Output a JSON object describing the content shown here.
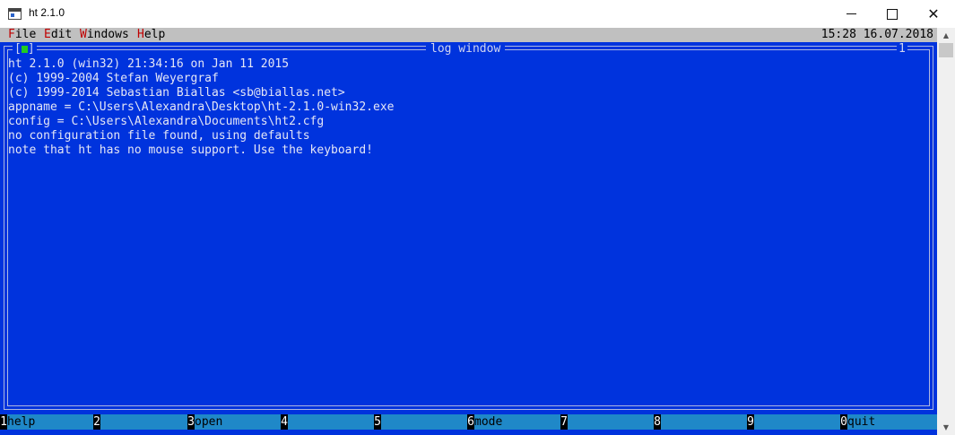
{
  "window": {
    "title": "ht 2.1.0"
  },
  "menubar": {
    "items": [
      {
        "hotkey": "F",
        "rest": "ile"
      },
      {
        "hotkey": "E",
        "rest": "dit"
      },
      {
        "hotkey": "W",
        "rest": "indows"
      },
      {
        "hotkey": "H",
        "rest": "elp"
      }
    ],
    "clock": "15:28 16.07.2018"
  },
  "log_window": {
    "title": "log window",
    "number": "1",
    "lines": [
      "ht 2.1.0 (win32) 21:34:16 on Jan 11 2015",
      "(c) 1999-2004 Stefan Weyergraf",
      "(c) 1999-2014 Sebastian Biallas <sb@biallas.net>",
      "appname = C:\\Users\\Alexandra\\Desktop\\ht-2.1.0-win32.exe",
      "config = C:\\Users\\Alexandra\\Documents\\ht2.cfg",
      "no configuration file found, using defaults",
      "note that ht has no mouse support. Use the keyboard!"
    ]
  },
  "fkeys": [
    {
      "num": "1",
      "label": "help"
    },
    {
      "num": "2",
      "label": ""
    },
    {
      "num": "3",
      "label": "open"
    },
    {
      "num": "4",
      "label": ""
    },
    {
      "num": "5",
      "label": ""
    },
    {
      "num": "6",
      "label": "mode"
    },
    {
      "num": "7",
      "label": ""
    },
    {
      "num": "8",
      "label": ""
    },
    {
      "num": "9",
      "label": ""
    },
    {
      "num": "0",
      "label": "quit"
    }
  ],
  "colors": {
    "console_bg": "#0033dd",
    "menubar_bg": "#c0c0c0",
    "hotkey": "#c00000",
    "fkey_bar": "#1f88c8",
    "close_box": "#22cc22"
  }
}
